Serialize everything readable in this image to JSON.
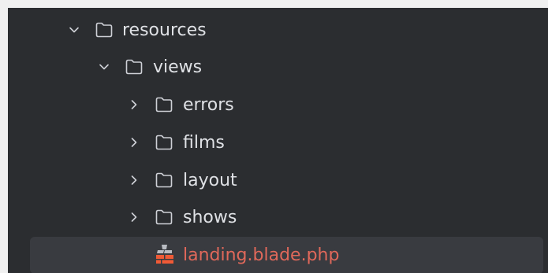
{
  "tree": {
    "items": [
      {
        "label": "resources",
        "type": "folder",
        "expanded": true,
        "depth": 0,
        "chevron": "chevron-down-icon",
        "icon": "folder-icon"
      },
      {
        "label": "views",
        "type": "folder",
        "expanded": true,
        "depth": 1,
        "chevron": "chevron-down-icon",
        "icon": "folder-icon"
      },
      {
        "label": "errors",
        "type": "folder",
        "expanded": false,
        "depth": 2,
        "chevron": "chevron-right-icon",
        "icon": "folder-icon"
      },
      {
        "label": "films",
        "type": "folder",
        "expanded": false,
        "depth": 2,
        "chevron": "chevron-right-icon",
        "icon": "folder-icon"
      },
      {
        "label": "layout",
        "type": "folder",
        "expanded": false,
        "depth": 2,
        "chevron": "chevron-right-icon",
        "icon": "folder-icon"
      },
      {
        "label": "shows",
        "type": "folder",
        "expanded": false,
        "depth": 2,
        "chevron": "chevron-right-icon",
        "icon": "folder-icon"
      },
      {
        "label": "landing.blade.php",
        "type": "file",
        "selected": true,
        "depth": 3,
        "icon": "blade-file-icon"
      }
    ]
  },
  "colors": {
    "background": "#2b2d30",
    "text": "#dfe1e5",
    "icon": "#ced0d6",
    "selected_row": "#393b40",
    "blade_file_text": "#e0685a",
    "blade_icon": "#f05a36"
  }
}
